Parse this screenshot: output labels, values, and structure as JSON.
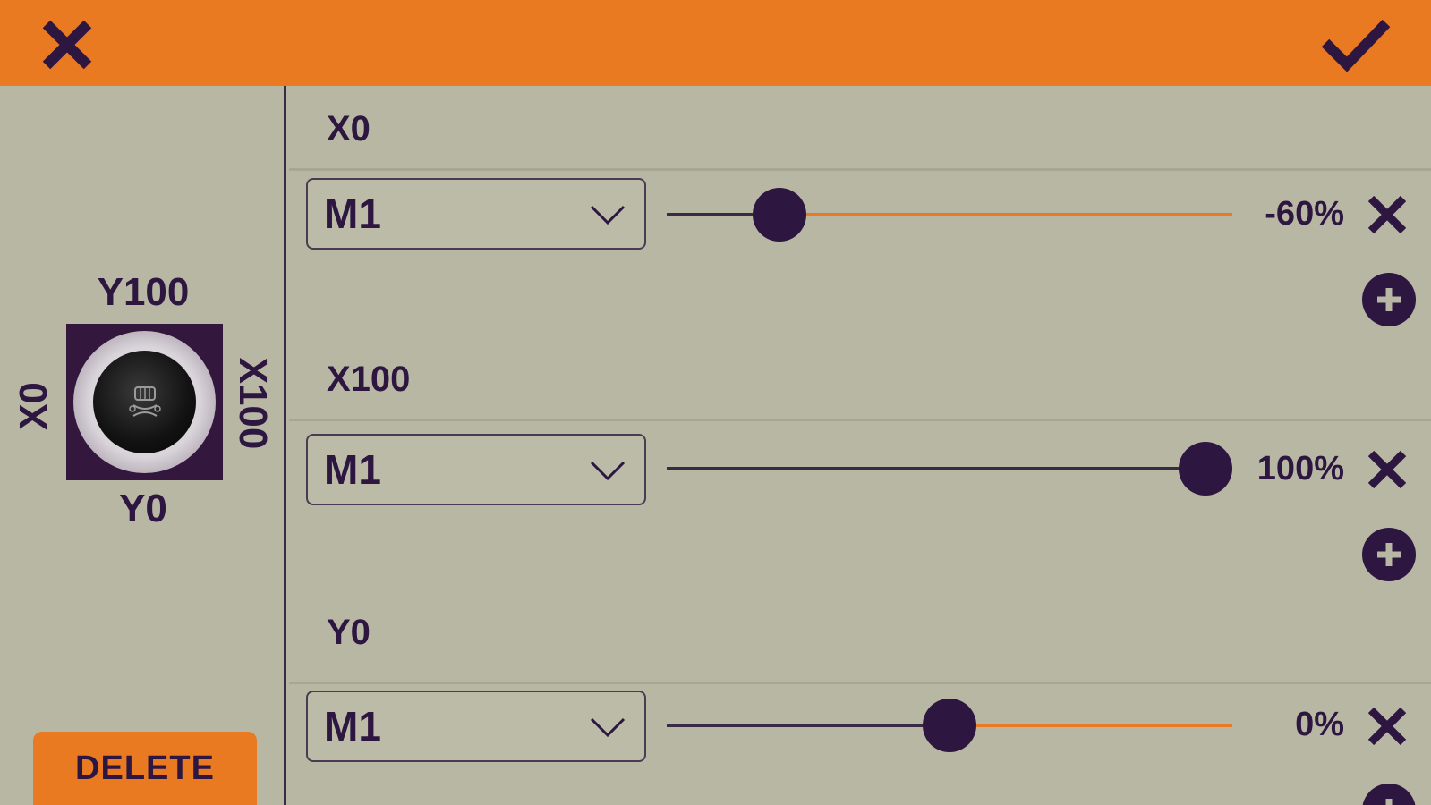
{
  "header": {
    "close_icon": "close-icon",
    "confirm_icon": "check-icon",
    "color": "#ea7a22"
  },
  "pad": {
    "top_label": "Y100",
    "bottom_label": "Y0",
    "left_label": "X0",
    "right_label": "X100",
    "knob_icon": "controller-icon"
  },
  "sidebar": {
    "delete_label": "DELETE"
  },
  "mappings": [
    {
      "axis_label": "X0",
      "target": "M1",
      "value_label": "-60%",
      "value": -60
    },
    {
      "axis_label": "X100",
      "target": "M1",
      "value_label": "100%",
      "value": 100
    },
    {
      "axis_label": "Y0",
      "target": "M1",
      "value_label": "0%",
      "value": 0
    }
  ],
  "colors": {
    "accent": "#ea7a22",
    "dark": "#2d1640",
    "background": "#b8b7a4"
  }
}
